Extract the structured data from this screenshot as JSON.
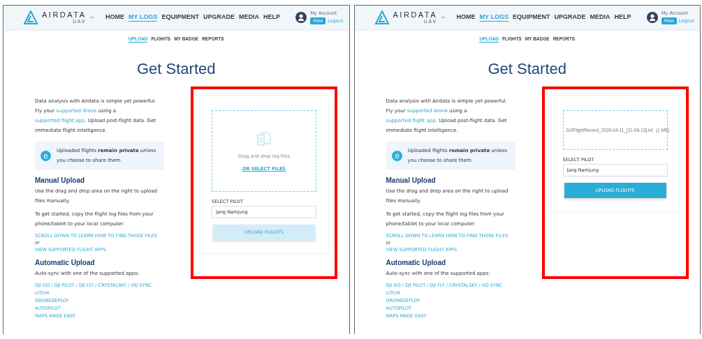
{
  "panels": [
    {
      "header": {
        "logo": "AIRDATA",
        "logo_sub": "UAV",
        "logo_mark": "™",
        "nav": [
          {
            "label": "HOME",
            "selected": false
          },
          {
            "label": "MY LOGS",
            "selected": true
          },
          {
            "label": "EQUIPMENT",
            "selected": false
          },
          {
            "label": "UPGRADE",
            "selected": false
          },
          {
            "label": "MEDIA",
            "selected": false
          },
          {
            "label": "HELP",
            "selected": false
          }
        ],
        "account": "My Account",
        "plan": "Free",
        "logout": "Logout"
      },
      "subnav": [
        {
          "label": "UPLOAD",
          "selected": true
        },
        {
          "label": "FLIGHTS",
          "selected": false
        },
        {
          "label": "MY BADGE",
          "selected": false
        },
        {
          "label": "REPORTS",
          "selected": false
        }
      ],
      "title": "Get Started",
      "intro": [
        {
          "text": "Data analysis with Airdata is simple yet powerful. Fly your ",
          "link": false
        },
        {
          "text": "supported drone",
          "link": true
        },
        {
          "text": " using a ",
          "link": false
        },
        {
          "text": "supported flight app",
          "link": true
        },
        {
          "text": ". Upload post-flight data. Get immediate flight intelligence.",
          "link": false
        }
      ],
      "privacy_note": "Uploaded flights **remain private** unless you choose to share them.",
      "manual": {
        "heading": "Manual Upload",
        "paragraphs": [
          "Use the drag and drop area on the right to upload files manually.",
          "To get started, copy the flight log files from your phone/tablet to your local computer."
        ],
        "link_1": "SCROLL DOWN TO LEARN HOW TO FIND THOSE FILES",
        "or": "or",
        "link_2": "VIEW SUPPORTED FLIGHT APPS"
      },
      "automatic": {
        "heading": "Automatic Upload",
        "text": "Auto-sync with one of the supported apps:",
        "apps": [
          "DJI GO / DJI PILOT / DJI FLY / CRYSTALSKY / HD SYNC",
          "LITCHI",
          "DRONEDEPLOY",
          "AUTOPILOT",
          "MAPS MADE EASY"
        ]
      },
      "uploader": {
        "highlighted": true,
        "dropzone": {
          "kind": "empty",
          "text": "Drag and drop log files",
          "link": "OR SELECT FILES"
        },
        "pilot_label": "SELECT PILOT",
        "pilot": "Jang Namjung",
        "button": {
          "label": "UPLOAD FLIGHTS",
          "disabled": true
        }
      }
    },
    {
      "header": {
        "logo": "AIRDATA",
        "logo_sub": "UAV",
        "logo_mark": "™",
        "nav": [
          {
            "label": "HOME",
            "selected": false
          },
          {
            "label": "MY LOGS",
            "selected": true
          },
          {
            "label": "EQUIPMENT",
            "selected": false
          },
          {
            "label": "UPGRADE",
            "selected": false
          },
          {
            "label": "MEDIA",
            "selected": false
          },
          {
            "label": "HELP",
            "selected": false
          }
        ],
        "account": "My Account",
        "plan": "Free",
        "logout": "Logout"
      },
      "subnav": [
        {
          "label": "UPLOAD",
          "selected": true
        },
        {
          "label": "FLIGHTS",
          "selected": false
        },
        {
          "label": "MY BADGE",
          "selected": false
        },
        {
          "label": "REPORTS",
          "selected": false
        }
      ],
      "title": "Get Started",
      "intro": [
        {
          "text": "Data analysis with Airdata is simple yet powerful. Fly your ",
          "link": false
        },
        {
          "text": "supported drone",
          "link": true
        },
        {
          "text": " using a ",
          "link": false
        },
        {
          "text": "supported flight app",
          "link": true
        },
        {
          "text": ". Upload post-flight data. Get immediate flight intelligence.",
          "link": false
        }
      ],
      "privacy_note": "Uploaded flights **remain private** unless you choose to share them.",
      "manual": {
        "heading": "Manual Upload",
        "paragraphs": [
          "Use the drag and drop area on the right to upload files manually.",
          "To get started, copy the flight log files from your phone/tablet to your local computer."
        ],
        "link_1": "SCROLL DOWN TO LEARN HOW TO FIND THOSE FILES",
        "or": "or",
        "link_2": "VIEW SUPPORTED FLIGHT APPS"
      },
      "automatic": {
        "heading": "Automatic Upload",
        "text": "Auto-sync with one of the supported apps:",
        "apps": [
          "DJI GO / DJI PILOT / DJI FLY / CRYSTALSKY / HD SYNC",
          "LITCHI",
          "DRONEDEPLOY",
          "AUTOPILOT",
          "MAPS MADE EASY"
        ]
      },
      "uploader": {
        "highlighted": true,
        "dropzone": {
          "kind": "file",
          "file_name": "DJIFlightRecord_2020-04-11_[11-06-13].txt",
          "file_size": "(1 MB)"
        },
        "pilot_label": "SELECT PILOT",
        "pilot": "Jang Namjung",
        "button": {
          "label": "UPLOAD FLIGHTS",
          "disabled": false
        }
      }
    }
  ]
}
